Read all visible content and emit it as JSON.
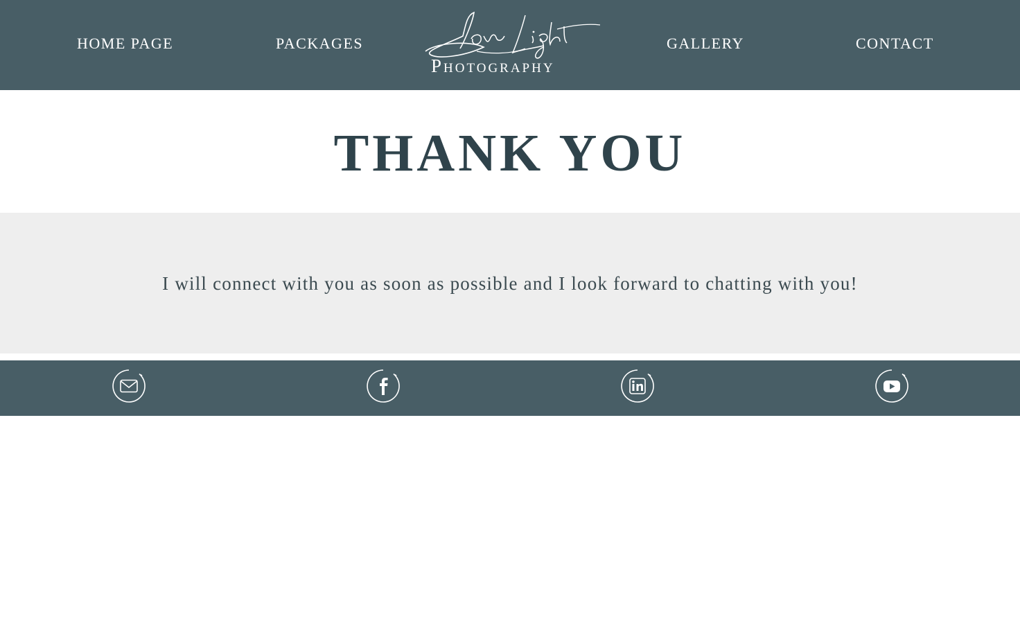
{
  "header": {
    "nav": {
      "home_label": "HOME PAGE",
      "packages_label": "PACKAGES",
      "gallery_label": "GALLERY",
      "contact_label": "CONTACT"
    },
    "logo": {
      "script_text": "Love Light",
      "subtitle": "Photography"
    }
  },
  "hero": {
    "title": "THANK YOU"
  },
  "message": {
    "text": "I will connect with you as soon as possible and I look forward to chatting with you!"
  },
  "footer": {
    "social_icons": [
      "email-icon",
      "facebook-icon",
      "linkedin-icon",
      "youtube-icon"
    ]
  },
  "colors": {
    "header_bg": "#485e66",
    "title_text": "#2f434b",
    "band_bg": "#eeeeee",
    "footer_bg": "#485e66"
  }
}
